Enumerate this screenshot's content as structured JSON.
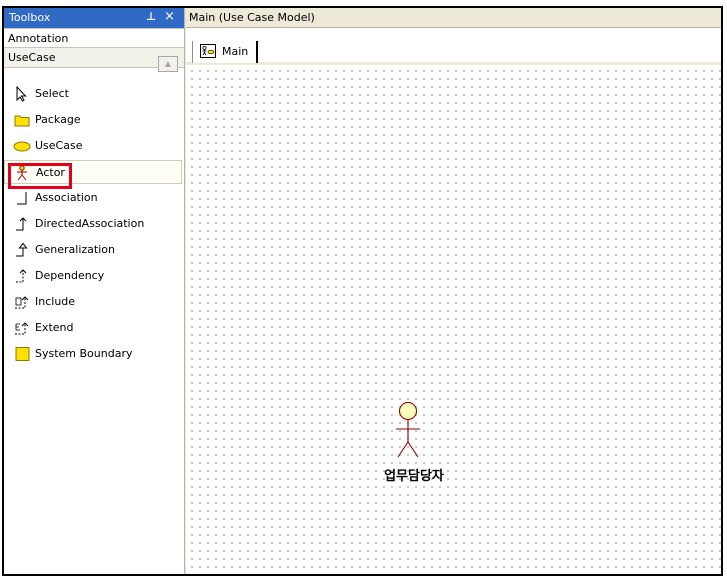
{
  "toolbox": {
    "title": "Toolbox",
    "pin_glyph": "⊥",
    "close_glyph": "×",
    "categories": [
      {
        "label": "Annotation"
      },
      {
        "label": "UseCase"
      }
    ],
    "scroll_glyph": "▲",
    "items": [
      {
        "label": "Select",
        "icon": "cursor-arrow-icon"
      },
      {
        "label": "Package",
        "icon": "folder-icon"
      },
      {
        "label": "UseCase",
        "icon": "ellipse-icon"
      },
      {
        "label": "Actor",
        "icon": "stick-figure-icon",
        "selected": true
      },
      {
        "label": "Association",
        "icon": "association-line-icon"
      },
      {
        "label": "DirectedAssociation",
        "icon": "directed-association-icon"
      },
      {
        "label": "Generalization",
        "icon": "generalization-icon"
      },
      {
        "label": "Dependency",
        "icon": "dependency-icon"
      },
      {
        "label": "Include",
        "icon": "include-icon"
      },
      {
        "label": "Extend",
        "icon": "extend-icon"
      },
      {
        "label": "System Boundary",
        "icon": "yellow-square-icon"
      }
    ]
  },
  "document": {
    "title": "Main (Use Case Model)",
    "tabs": [
      {
        "label": "Main",
        "icon": "diagram-icon"
      }
    ]
  },
  "diagram": {
    "elements": [
      {
        "type": "actor",
        "name": "업무담당자"
      }
    ]
  },
  "colors": {
    "titlebar": "#316ac5",
    "highlight": "#e3001b",
    "actor_stroke": "#8b0000",
    "actor_fill": "#ffffc0"
  }
}
